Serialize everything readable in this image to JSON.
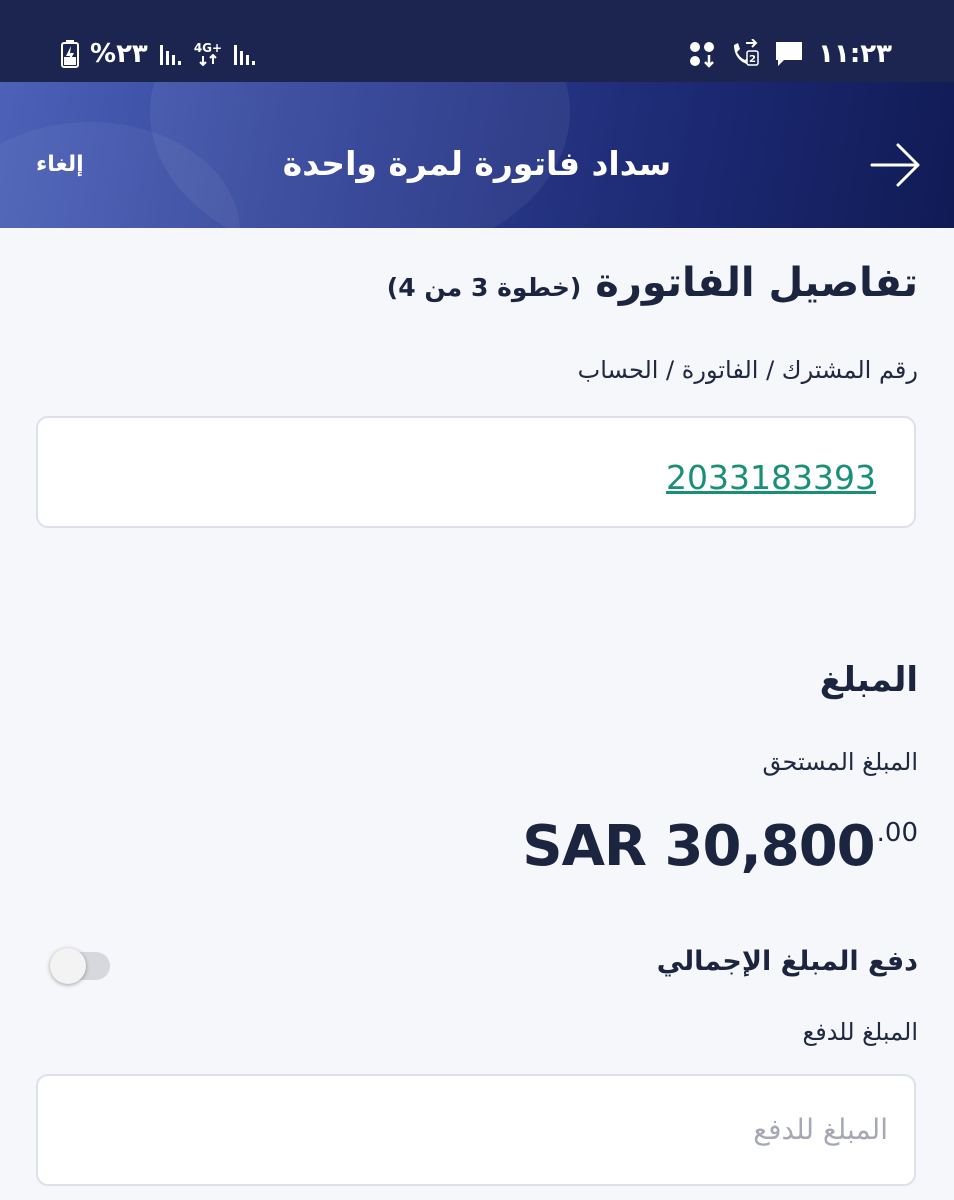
{
  "status_bar": {
    "time": "١١:٢٣",
    "battery": "%٢٣",
    "network": "4G+",
    "icons": [
      "bolt-battery-icon",
      "signal-icon",
      "network-4g-icon",
      "signal-icon",
      "data-saver-icon",
      "call-forward-sim2-icon",
      "message-icon"
    ]
  },
  "header": {
    "title": "سداد فاتورة لمرة واحدة",
    "cancel_label": "إلغاء",
    "back_icon": "arrow-right-icon",
    "gradient": [
      "#4c61b8",
      "#101b55"
    ]
  },
  "bill_details": {
    "title": "تفاصيل الفاتورة",
    "step": "(خطوة 3 من 4)",
    "field_label": "رقم المشترك / الفاتورة / الحساب",
    "account_number": "2033183393",
    "link_color": "#1a8f77"
  },
  "amount": {
    "section_title": "المبلغ",
    "due_label": "المبلغ المستحق",
    "due_value": "SAR 30,800",
    "due_decimals": ".00",
    "pay_full_label": "دفع المبلغ الإجمالي",
    "pay_full_enabled": false,
    "pay_amount_label": "المبلغ للدفع",
    "pay_amount_placeholder": "المبلغ للدفع",
    "pay_amount_value": ""
  }
}
